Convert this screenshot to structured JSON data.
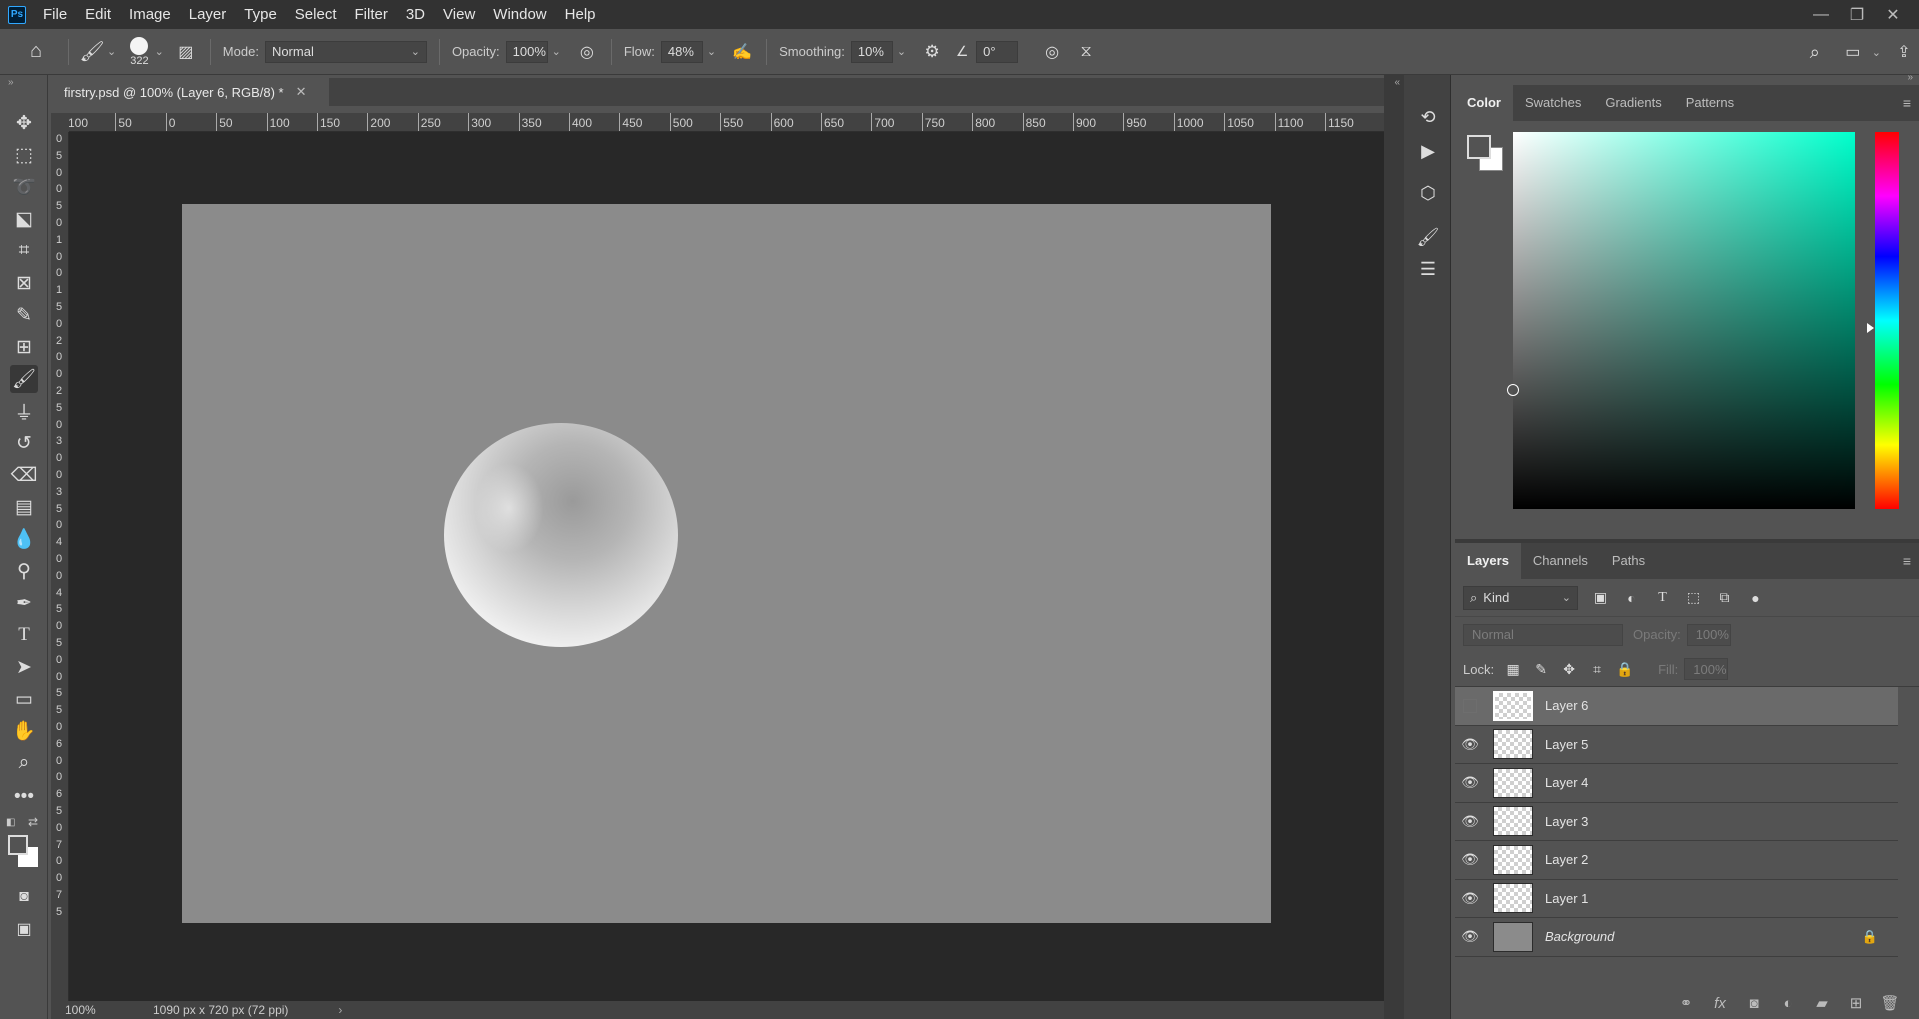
{
  "app": {
    "logo": "Ps"
  },
  "menu": [
    "File",
    "Edit",
    "Image",
    "Layer",
    "Type",
    "Select",
    "Filter",
    "3D",
    "View",
    "Window",
    "Help"
  ],
  "options": {
    "brush_size": "322",
    "mode_label": "Mode:",
    "mode_value": "Normal",
    "opacity_label": "Opacity:",
    "opacity_value": "100%",
    "flow_label": "Flow:",
    "flow_value": "48%",
    "smoothing_label": "Smoothing:",
    "smoothing_value": "10%",
    "angle_value": "0°"
  },
  "document": {
    "tab_title": "firstry.psd @ 100% (Layer 6, RGB/8) *",
    "zoom": "100%",
    "info": "1090 px x 720 px (72 ppi)"
  },
  "ruler_h": [
    "100",
    "50",
    "0",
    "50",
    "100",
    "150",
    "200",
    "250",
    "300",
    "350",
    "400",
    "450",
    "500",
    "550",
    "600",
    "650",
    "700",
    "750",
    "800",
    "850",
    "900",
    "950",
    "1000",
    "1050",
    "1100",
    "1150"
  ],
  "ruler_v": [
    "0",
    "5",
    "0",
    "0",
    "5",
    "0",
    "1",
    "0",
    "0",
    "1",
    "5",
    "0",
    "2",
    "0",
    "0",
    "2",
    "5",
    "0",
    "3",
    "0",
    "0",
    "3",
    "5",
    "0",
    "4",
    "0",
    "0",
    "4",
    "5",
    "0",
    "5",
    "0",
    "0",
    "5",
    "5",
    "0",
    "6",
    "0",
    "0",
    "6",
    "5",
    "0",
    "7",
    "0",
    "0",
    "7",
    "5"
  ],
  "color_panel": {
    "tabs": [
      "Color",
      "Swatches",
      "Gradients",
      "Patterns"
    ],
    "active_tab": "Color"
  },
  "layers_panel": {
    "tabs": [
      "Layers",
      "Channels",
      "Paths"
    ],
    "kind_label": "Kind",
    "blend_mode": "Normal",
    "opacity_label": "Opacity:",
    "opacity_value": "100%",
    "lock_label": "Lock:",
    "fill_label": "Fill:",
    "fill_value": "100%",
    "layers": [
      {
        "name": "Layer 6",
        "visible": false,
        "selected": true
      },
      {
        "name": "Layer 5",
        "visible": true,
        "selected": false
      },
      {
        "name": "Layer 4",
        "visible": true,
        "selected": false
      },
      {
        "name": "Layer 3",
        "visible": true,
        "selected": false
      },
      {
        "name": "Layer 2",
        "visible": true,
        "selected": false
      },
      {
        "name": "Layer 1",
        "visible": true,
        "selected": false
      },
      {
        "name": "Background",
        "visible": true,
        "selected": false,
        "locked": true
      }
    ]
  },
  "colors": {
    "accent": "#31a8ff",
    "canvas_bg": "#282828",
    "doc_bg": "#8b8b8b"
  }
}
